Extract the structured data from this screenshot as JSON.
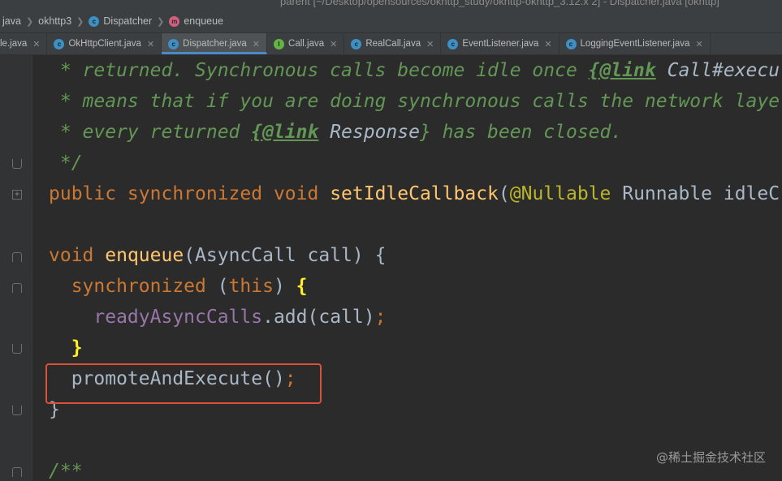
{
  "window": {
    "title": "parent [~/Desktop/opensources/okhttp_study/okhttp-okhttp_3.12.x 2] - Dispatcher.java [okhttp]"
  },
  "breadcrumb": {
    "items": [
      {
        "label": "java",
        "icon": "folder-icon"
      },
      {
        "label": "okhttp3",
        "icon": "folder-icon"
      },
      {
        "label": "Dispatcher",
        "icon": "class-icon"
      },
      {
        "label": "enqueue",
        "icon": "method-icon"
      }
    ]
  },
  "tabs": [
    {
      "label": "le.java",
      "icon": "",
      "active": false
    },
    {
      "label": "OkHttpClient.java",
      "icon": "class-icon",
      "active": false
    },
    {
      "label": "Dispatcher.java",
      "icon": "class-icon",
      "active": true
    },
    {
      "label": "Call.java",
      "icon": "interface-icon",
      "active": false
    },
    {
      "label": "RealCall.java",
      "icon": "class-icon",
      "active": false
    },
    {
      "label": "EventListener.java",
      "icon": "abstract-class-icon",
      "active": false
    },
    {
      "label": "LoggingEventListener.java",
      "icon": "class-icon",
      "active": false
    }
  ],
  "code": {
    "line1": {
      "p1": " * returned. Synchronous calls become idle once ",
      "tag": "{@link",
      "ref": " Call#execu"
    },
    "line2": {
      "p1": " * means that if you are doing synchronous calls the network laye"
    },
    "line3": {
      "p1": " * every returned ",
      "tag": "{@link",
      "ref": " Response",
      "p2": "} has been closed."
    },
    "line4": {
      "p1": " */"
    },
    "line5": {
      "kw1": "public synchronized void ",
      "fn": "setIdleCallback",
      "p1": "(",
      "ann": "@Nullable",
      "p2": " Runnable idleC"
    },
    "line7": {
      "kw1": "void ",
      "fn": "enqueue",
      "p1": "(AsyncCall call) {"
    },
    "line8": {
      "kw1": "  synchronized ",
      "p1": "(",
      "kw2": "this",
      "p2": ") ",
      "brace": "{"
    },
    "line9": {
      "field": "    readyAsyncCalls",
      "p1": ".add(call)",
      "semi": ";"
    },
    "line10": {
      "brace": "  }"
    },
    "line11": {
      "p1": "  promoteAndExecute()",
      "semi": ";"
    },
    "line12": {
      "p1": "}"
    },
    "line14": {
      "p1": "/**"
    }
  },
  "watermark": "@稀土掘金技术社区",
  "colors": {
    "highlight_box": "#d9503b",
    "active_tab_underline": "#4a88c7"
  }
}
